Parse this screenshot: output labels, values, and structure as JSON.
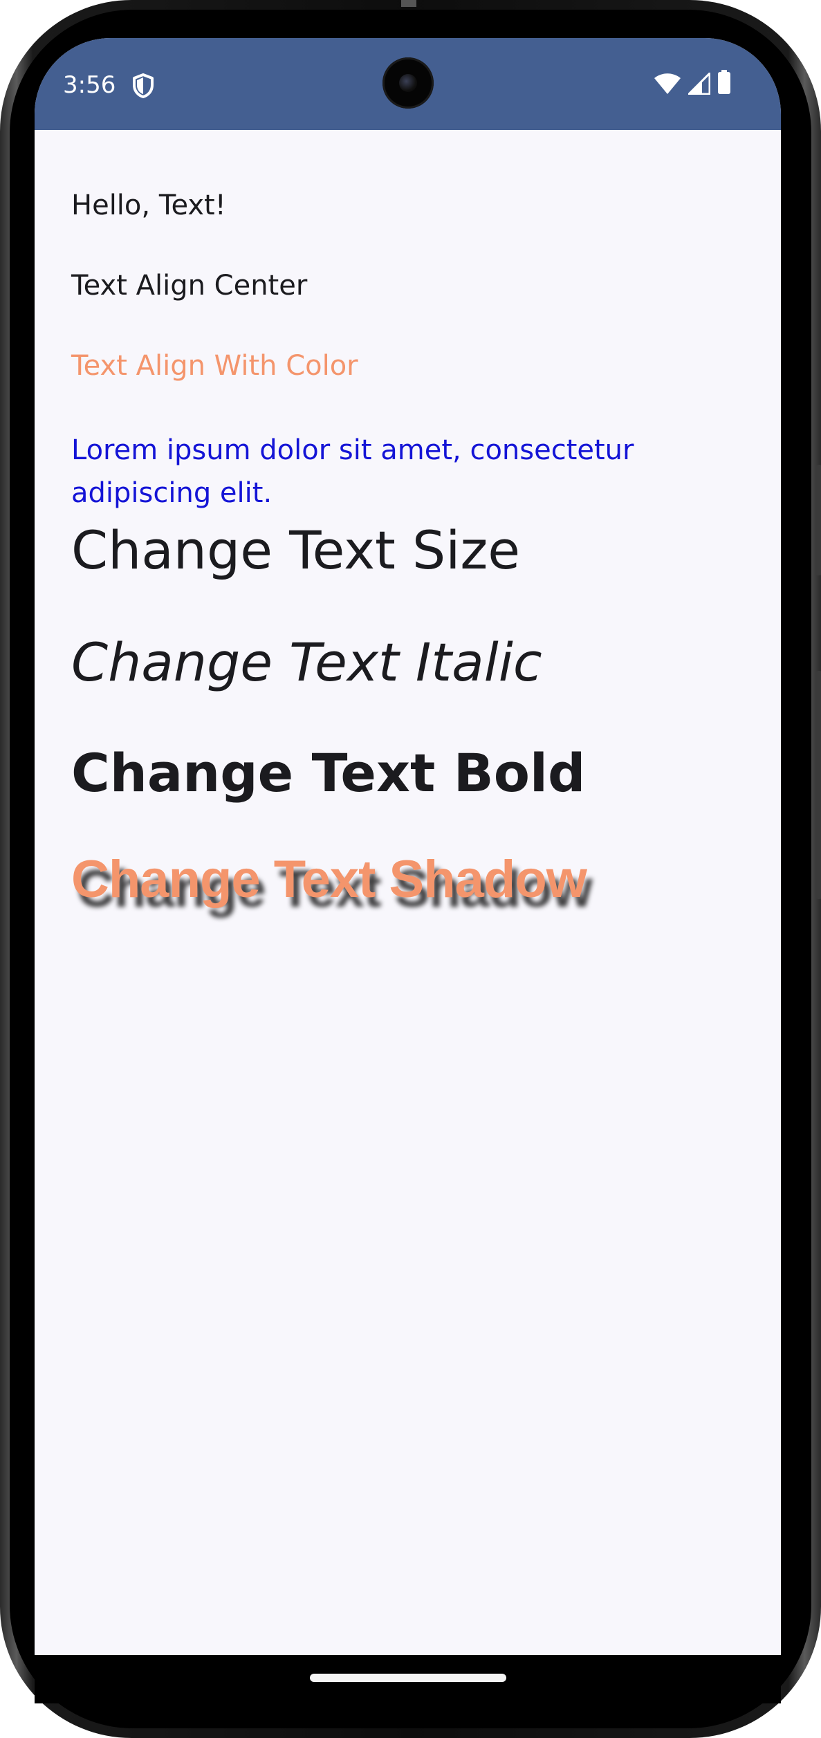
{
  "status_bar": {
    "time": "3:56",
    "color": "#445f91",
    "icons": [
      "shield-icon",
      "wifi-icon",
      "cell-signal-icon",
      "battery-icon"
    ]
  },
  "texts": {
    "hello": "Hello, Text!",
    "align_center": "Text Align Center",
    "align_color": "Text Align With Color",
    "lorem": "Lorem ipsum dolor sit amet, consectetur adipiscing elit.",
    "size": "Change Text Size",
    "italic": "Change Text Italic",
    "bold": "Change Text Bold",
    "shadow": "Change Text Shadow"
  },
  "colors": {
    "background": "#f8f7fc",
    "text": "#1b1b1f",
    "accent_orange": "#f4956c",
    "blue": "#1414d6"
  }
}
